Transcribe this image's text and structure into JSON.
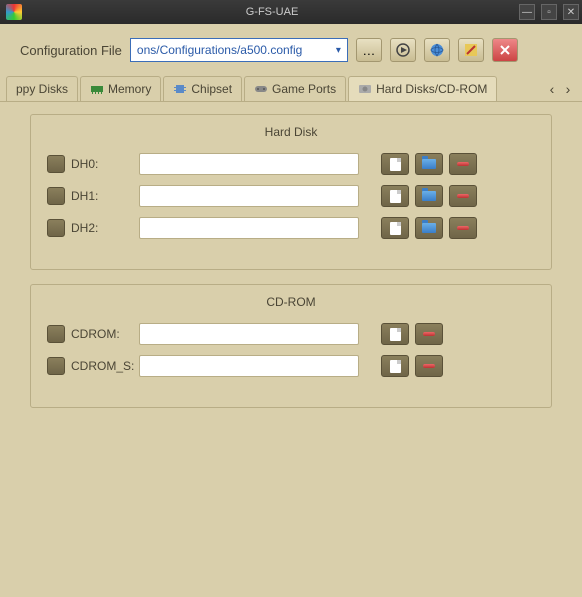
{
  "titlebar": {
    "title": "G-FS-UAE"
  },
  "toolbar": {
    "label": "Configuration File",
    "config_value": "ons/Configurations/a500.config"
  },
  "tabs": {
    "items": [
      {
        "label": "ppy Disks"
      },
      {
        "label": "Memory"
      },
      {
        "label": "Chipset"
      },
      {
        "label": "Game Ports"
      },
      {
        "label": "Hard Disks/CD-ROM"
      }
    ]
  },
  "panels": {
    "harddisk": {
      "title": "Hard Disk",
      "rows": [
        {
          "label": "DH0:",
          "value": ""
        },
        {
          "label": "DH1:",
          "value": ""
        },
        {
          "label": "DH2:",
          "value": ""
        }
      ]
    },
    "cdrom": {
      "title": "CD-ROM",
      "rows": [
        {
          "label": "CDROM:",
          "value": ""
        },
        {
          "label": "CDROM_S:",
          "value": ""
        }
      ]
    }
  }
}
